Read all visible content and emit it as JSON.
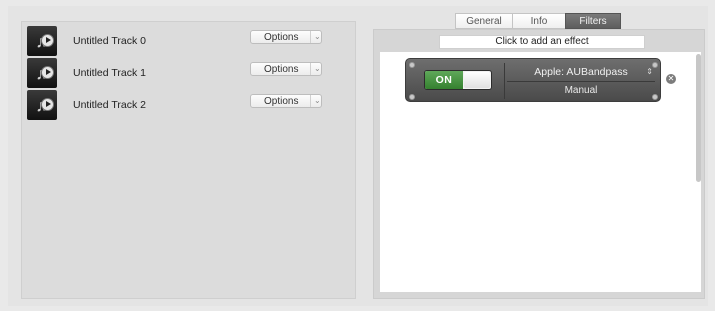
{
  "tracks": [
    {
      "name": "Untitled Track 0",
      "options_label": "Options"
    },
    {
      "name": "Untitled Track 1",
      "options_label": "Options"
    },
    {
      "name": "Untitled Track 2",
      "options_label": "Options"
    }
  ],
  "tabs": [
    {
      "label": "General",
      "active": false
    },
    {
      "label": "Info",
      "active": false
    },
    {
      "label": "Filters",
      "active": true
    }
  ],
  "effects": {
    "add_label": "Click to add an effect",
    "unit": {
      "toggle_label": "ON",
      "name": "Apple: AUBandpass",
      "preset": "Manual",
      "enabled": true
    }
  },
  "icons": {
    "track": "music-note-play-icon",
    "remove": "close-circle-icon",
    "dropdown": "chevron-down-icon",
    "stepper": "up-down-stepper-icon"
  },
  "colors": {
    "toggle_on": "#3f8f39",
    "active_tab": "#666666"
  }
}
